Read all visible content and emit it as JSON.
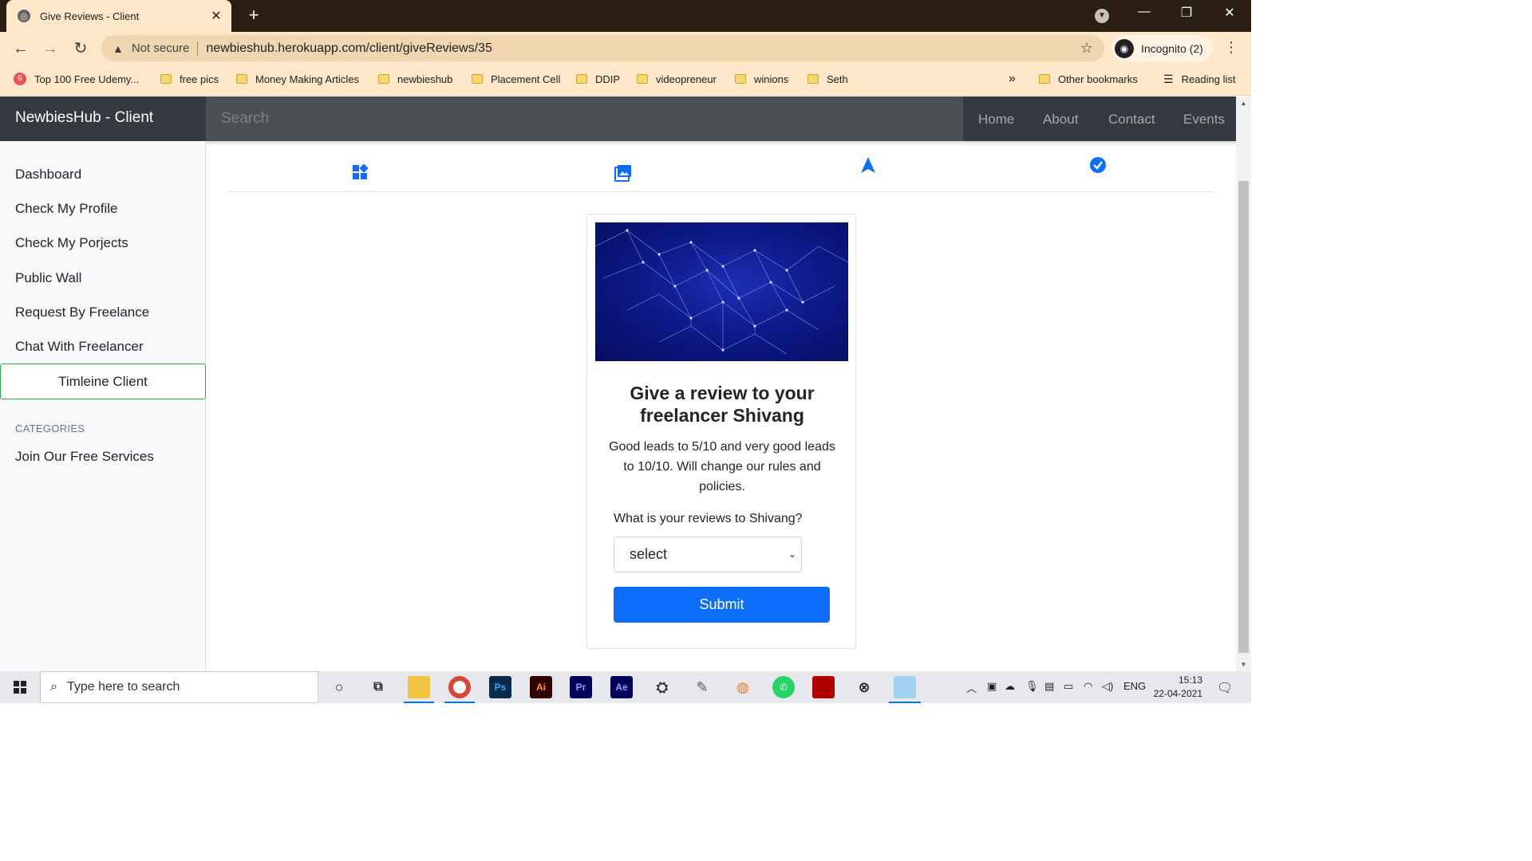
{
  "browser": {
    "tab_title": "Give Reviews - Client",
    "security_label": "Not secure",
    "url": "newbieshub.herokuapp.com/client/giveReviews/35",
    "profile_label": "Incognito (2)",
    "bookmarks": [
      "Top 100 Free Udemy...",
      "free pics",
      "Money Making Articles",
      "newbieshub",
      "Placement Cell",
      "DDIP",
      "videopreneur",
      "winions",
      "Seth"
    ],
    "bookmarks_overflow": "»",
    "other_bookmarks": "Other bookmarks",
    "reading_list": "Reading list"
  },
  "navbar": {
    "brand": "NewbiesHub - Client",
    "search_placeholder": "Search",
    "links": [
      "Home",
      "About",
      "Contact",
      "Events"
    ]
  },
  "sidebar": {
    "items": [
      "Dashboard",
      "Check My Profile",
      "Check My Porjects",
      "Public Wall",
      "Request By Freelance",
      "Chat With Freelancer"
    ],
    "active_item": "Timleine Client",
    "category_heading": "CATEGORIES",
    "category_items": [
      "Join Our Free Services"
    ]
  },
  "steps": {
    "icons": [
      "dashboard-icon",
      "image-icon",
      "navigation-arrow-icon",
      "check-circle-icon"
    ],
    "accent_color": "#0d6efd"
  },
  "review_card": {
    "title": "Give a review to your freelancer Shivang",
    "description": "Good leads to 5/10 and very good leads to 10/10. Will change our rules and policies.",
    "question": "What is your reviews to Shivang?",
    "select_value": "select",
    "submit_label": "Submit",
    "button_color": "#0d6efd"
  },
  "taskbar": {
    "search_placeholder": "Type here to search",
    "language": "ENG",
    "time": "15:13",
    "date": "22-04-2021"
  }
}
